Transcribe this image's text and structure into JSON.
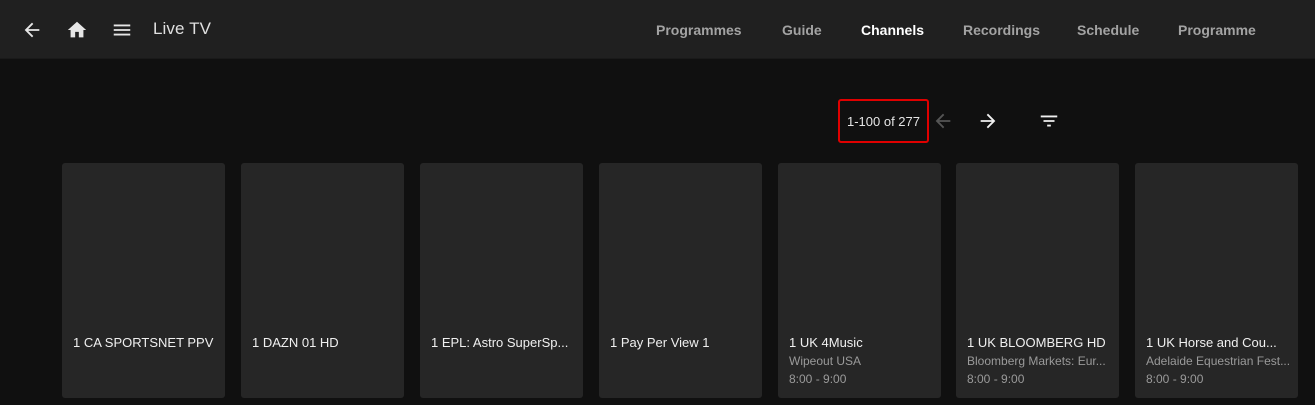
{
  "header": {
    "title": "Live TV",
    "back_icon": "arrow-left-icon",
    "home_icon": "home-icon",
    "menu_icon": "hamburger-menu-icon"
  },
  "nav": {
    "tabs": [
      {
        "label": "Programmes",
        "active": false
      },
      {
        "label": "Guide",
        "active": false
      },
      {
        "label": "Channels",
        "active": true
      },
      {
        "label": "Recordings",
        "active": false
      },
      {
        "label": "Schedule",
        "active": false
      },
      {
        "label": "Programme",
        "active": false
      }
    ]
  },
  "toolbar": {
    "range_text": "1-100 of 277",
    "prev_icon": "arrow-left-icon",
    "prev_enabled": false,
    "next_icon": "arrow-right-icon",
    "next_enabled": true,
    "filter_icon": "filter-icon"
  },
  "channels": [
    {
      "name": "1 CA SPORTSNET PPV",
      "program": "",
      "time": ""
    },
    {
      "name": "1 DAZN 01 HD",
      "program": "",
      "time": ""
    },
    {
      "name": "1 EPL: Astro SuperSp...",
      "program": "",
      "time": ""
    },
    {
      "name": "1 Pay Per View 1",
      "program": "",
      "time": ""
    },
    {
      "name": "1 UK 4Music",
      "program": "Wipeout USA",
      "time": "8:00 - 9:00"
    },
    {
      "name": "1 UK BLOOMBERG HD",
      "program": "Bloomberg Markets: Eur...",
      "time": "8:00 - 9:00"
    },
    {
      "name": "1 UK Horse and Cou...",
      "program": "Adelaide Equestrian Fest...",
      "time": "8:00 - 9:00"
    }
  ],
  "colors": {
    "header_bg": "#202020",
    "page_bg": "#101010",
    "card_bg": "#262626",
    "highlight_border": "#e00000"
  }
}
